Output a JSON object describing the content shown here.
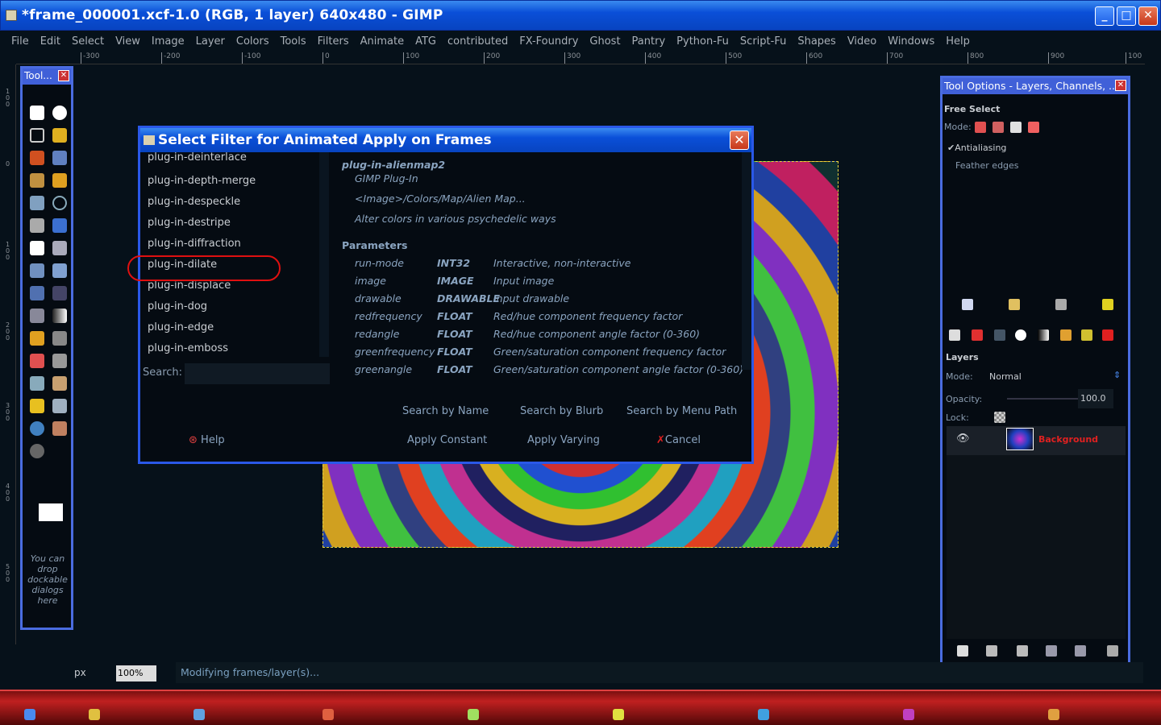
{
  "window": {
    "title": "*frame_000001.xcf-1.0 (RGB, 1 layer) 640x480 - GIMP",
    "minimize": "_",
    "maximize": "□",
    "close": "✕"
  },
  "menu": [
    "File",
    "Edit",
    "Select",
    "View",
    "Image",
    "Layer",
    "Colors",
    "Tools",
    "Filters",
    "Animate",
    "ATG",
    "contributed",
    "FX-Foundry",
    "Ghost",
    "Pantry",
    "Python-Fu",
    "Script-Fu",
    "Shapes",
    "Video",
    "Windows",
    "Help"
  ],
  "ruler": [
    "-300",
    "-200",
    "-100",
    "0",
    "100",
    "200",
    "300",
    "400",
    "500",
    "600",
    "700",
    "800",
    "900",
    "100"
  ],
  "vruler": [
    "1 0 0",
    "0",
    "1 0 0",
    "2 0 0",
    "3 0 0",
    "4 0 0",
    "5 0 0"
  ],
  "toolbox": {
    "title": "Tool...",
    "close": "✕",
    "drop_note": "You can drop dockable dialogs here"
  },
  "dialog": {
    "title": "Select Filter for Animated Apply on Frames",
    "close": "✕",
    "filters": [
      "plug-in-deinterlace",
      "plug-in-depth-merge",
      "plug-in-despeckle",
      "plug-in-destripe",
      "plug-in-diffraction",
      "plug-in-dilate",
      "plug-in-displace",
      "plug-in-dog",
      "plug-in-edge",
      "plug-in-emboss"
    ],
    "search_label": "Search:",
    "info": {
      "name": "plug-in-alienmap2",
      "type": "GIMP Plug-In",
      "menu_path": "<Image>/Colors/Map/Alien Map...",
      "blurb": "Alter colors in various psychedelic ways"
    },
    "params_header": "Parameters",
    "params": [
      {
        "name": "run-mode",
        "type": "INT32",
        "desc": "Interactive, non-interactive"
      },
      {
        "name": "image",
        "type": "IMAGE",
        "desc": "Input image"
      },
      {
        "name": "drawable",
        "type": "DRAWABLE",
        "desc": "Input drawable"
      },
      {
        "name": "redfrequency",
        "type": "FLOAT",
        "desc": "Red/hue component frequency factor"
      },
      {
        "name": "redangle",
        "type": "FLOAT",
        "desc": "Red/hue component angle factor (0-360)"
      },
      {
        "name": "greenfrequency",
        "type": "FLOAT",
        "desc": "Green/saturation component frequency factor"
      },
      {
        "name": "greenangle",
        "type": "FLOAT",
        "desc": "Green/saturation component angle factor (0-360)"
      }
    ],
    "buttons": {
      "search_name": "Search by Name",
      "search_blurb": "Search by Blurb",
      "search_menu": "Search by Menu Path",
      "help": "Help",
      "apply_constant": "Apply Constant",
      "apply_varying": "Apply Varying",
      "cancel": "Cancel"
    }
  },
  "dock": {
    "title": "Tool Options - Layers, Channels, ...",
    "close": "✕",
    "tool": "Free Select",
    "mode_label": "Mode:",
    "antialiasing": "Antialiasing",
    "feather": "Feather edges",
    "layers_label": "Layers",
    "layer_mode_label": "Mode:",
    "layer_mode": "Normal",
    "opacity_label": "Opacity:",
    "opacity": "100.0",
    "lock_label": "Lock:",
    "layer_name": "Background"
  },
  "status": {
    "unit": "px",
    "zoom": "100",
    "zoom_suffix": "%",
    "message": "Modifying frames/layer(s)..."
  },
  "colors": {
    "accent": "#2a58e8",
    "highlight": "#e01010"
  }
}
